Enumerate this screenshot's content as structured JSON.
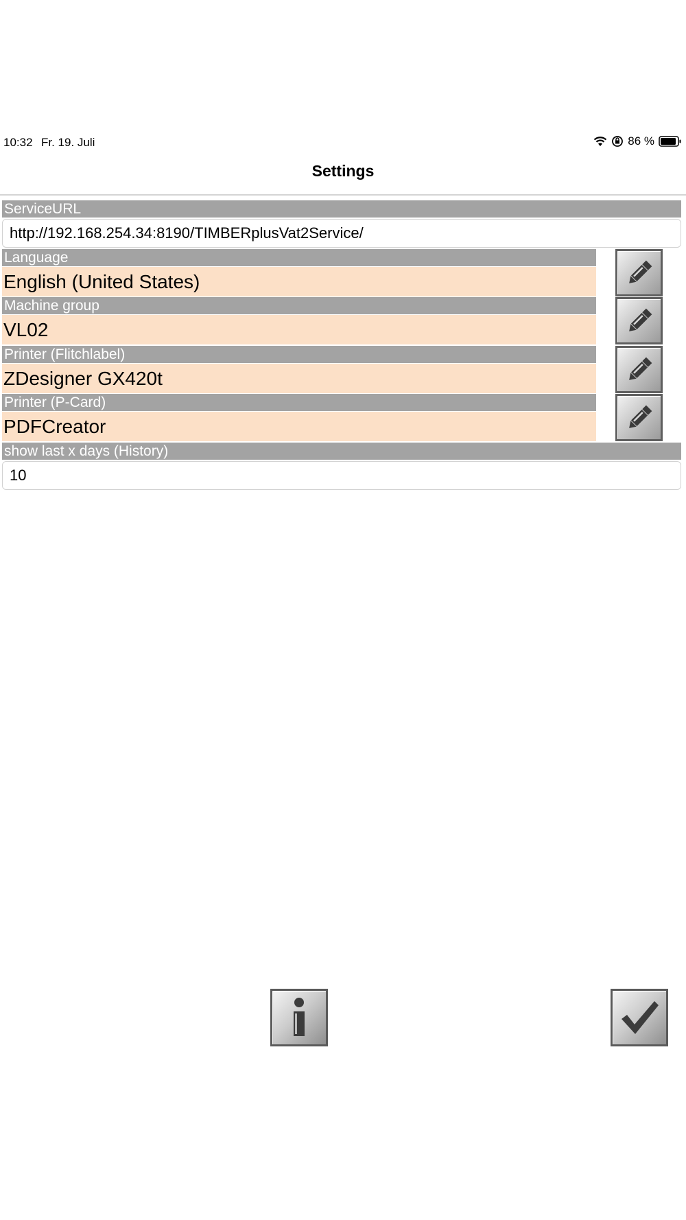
{
  "status_bar": {
    "time": "10:32",
    "date": "Fr. 19. Juli",
    "battery": "86 %",
    "icons": [
      "wifi-icon",
      "orientation-lock-icon",
      "battery-icon"
    ]
  },
  "nav": {
    "title": "Settings"
  },
  "fields": {
    "service_url": {
      "label": "ServiceURL",
      "value": "http://192.168.254.34:8190/TIMBERplusVat2Service/"
    },
    "language": {
      "label": "Language",
      "value": "English (United States)"
    },
    "machine_group": {
      "label": "Machine group",
      "value": "VL02"
    },
    "printer_flitchlabel": {
      "label": "Printer (Flitchlabel)",
      "value": "ZDesigner GX420t"
    },
    "printer_pcard": {
      "label": "Printer (P-Card)",
      "value": "PDFCreator"
    },
    "history_days": {
      "label": "show last x days (History)",
      "value": "10"
    }
  },
  "buttons": {
    "edit_icon": "pencil-icon",
    "info_icon": "info-icon",
    "confirm_icon": "checkmark-icon"
  },
  "colors": {
    "label_bg": "#a3a3a3",
    "value_bg": "#fce0c7",
    "button_border": "#5f5f5f"
  }
}
